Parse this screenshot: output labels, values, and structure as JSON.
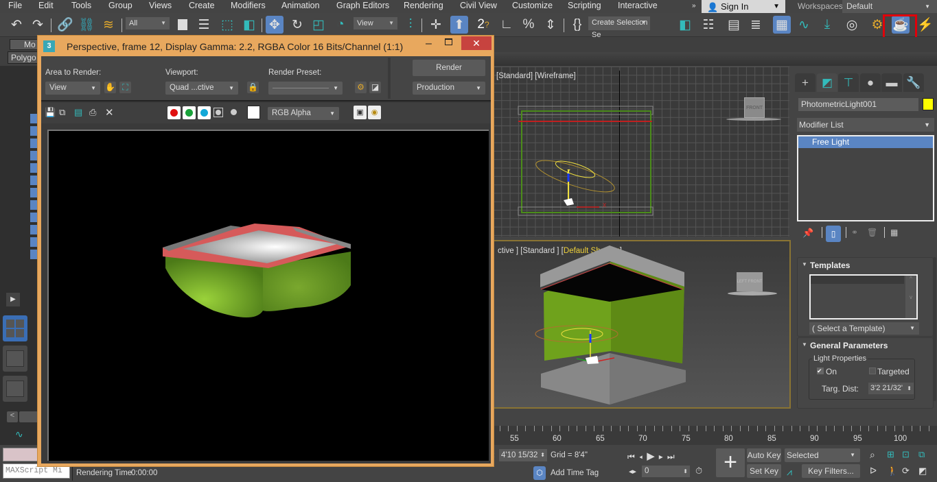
{
  "menu": {
    "items": [
      "File",
      "Edit",
      "Tools",
      "Group",
      "Views",
      "Create",
      "Modifiers",
      "Animation",
      "Graph Editors",
      "Rendering",
      "Civil View",
      "Customize",
      "Scripting",
      "Interactive"
    ],
    "overflow": "»",
    "sign_in": "Sign In",
    "workspaces_label": "Workspaces:",
    "workspace_value": "Default"
  },
  "toolbar": {
    "selection_filter": "All",
    "ref_coord": "View",
    "named_selection": "Create Selection Se",
    "highlighted_tool": "rendered-frame-window-icon"
  },
  "ribbon": {
    "tab_label": "Mo",
    "sub_label": "Polygo"
  },
  "render_window": {
    "title": "Perspective, frame 12, Display Gamma: 2.2, RGBA Color 16 Bits/Channel (1:1)",
    "icon_glyph": "3",
    "area_label": "Area to Render:",
    "area_value": "View",
    "viewport_label": "Viewport:",
    "viewport_value": "Quad ...ctive",
    "preset_label": "Render Preset:",
    "preset_value": "",
    "render_button": "Render",
    "render_mode": "Production",
    "channel_display": "RGB Alpha",
    "close_glyph": "✕"
  },
  "viewports": {
    "top_label": "[Standard] [Wireframe]",
    "top_viewcube": "FRONT",
    "persp_label_prefix": "ctive ] [Standard ] [",
    "persp_shading": "Default Shading",
    "persp_label_suffix": "]",
    "persp_viewcube_left": "LEFT",
    "persp_viewcube_front": "FRONT"
  },
  "command_panel": {
    "object_name": "PhotometricLight001",
    "object_color": "#ffff00",
    "modifier_list": "Modifier List",
    "stack_items": [
      "Free Light"
    ],
    "templates_title": "Templates",
    "template_select": "( Select a Template)",
    "general_title": "General Parameters",
    "light_props_label": "Light Properties",
    "on_label": "On",
    "on_checked": true,
    "targeted_label": "Targeted",
    "targeted_checked": false,
    "targ_dist_label": "Targ. Dist:",
    "targ_dist_value": "3'2 21/32'"
  },
  "timeline": {
    "labels": [
      "55",
      "60",
      "65",
      "70",
      "75",
      "80",
      "85",
      "90",
      "95",
      "100"
    ]
  },
  "status": {
    "maxscript": "MAXScript Mi",
    "rendering_time_label": "Rendering Time",
    "rendering_time": "0:00:00",
    "coord_prefix": ":",
    "coord_value": "4'10 15/32",
    "grid": "Grid = 8'4\"",
    "add_time_tag": "Add Time Tag",
    "frame_value": "0",
    "auto_key": "Auto Key",
    "set_key": "Set Key",
    "key_mode": "Selected",
    "key_filters": "Key Filters..."
  }
}
